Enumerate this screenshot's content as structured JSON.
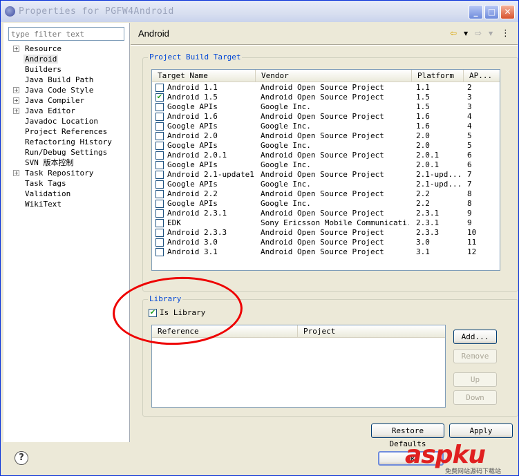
{
  "window": {
    "title": "Properties for PGFW4Android",
    "controls": [
      "minimize-icon",
      "maximize-icon",
      "close-icon"
    ]
  },
  "sidebar": {
    "filter_placeholder": "type filter text",
    "items": [
      {
        "label": "Resource",
        "expandable": true
      },
      {
        "label": "Android",
        "expandable": false,
        "selected": true
      },
      {
        "label": "Builders",
        "expandable": false
      },
      {
        "label": "Java Build Path",
        "expandable": false
      },
      {
        "label": "Java Code Style",
        "expandable": true
      },
      {
        "label": "Java Compiler",
        "expandable": true
      },
      {
        "label": "Java Editor",
        "expandable": true
      },
      {
        "label": "Javadoc Location",
        "expandable": false
      },
      {
        "label": "Project References",
        "expandable": false
      },
      {
        "label": "Refactoring History",
        "expandable": false
      },
      {
        "label": "Run/Debug Settings",
        "expandable": false
      },
      {
        "label": "SVN 版本控制",
        "expandable": false
      },
      {
        "label": "Task Repository",
        "expandable": true
      },
      {
        "label": "Task Tags",
        "expandable": false
      },
      {
        "label": "Validation",
        "expandable": false
      },
      {
        "label": "WikiText",
        "expandable": false
      }
    ]
  },
  "main": {
    "title": "Android",
    "nav": {
      "back_icon": "back-arrow-icon",
      "forward_icon": "forward-arrow-icon"
    },
    "build_target": {
      "label": "Project Build Target",
      "columns": [
        "Target Name",
        "Vendor",
        "Platform",
        "AP..."
      ],
      "rows": [
        {
          "checked": false,
          "name": "Android 1.1",
          "vendor": "Android Open Source Project",
          "platform": "1.1",
          "api": "2"
        },
        {
          "checked": true,
          "name": "Android 1.5",
          "vendor": "Android Open Source Project",
          "platform": "1.5",
          "api": "3"
        },
        {
          "checked": false,
          "name": "Google APIs",
          "vendor": "Google Inc.",
          "platform": "1.5",
          "api": "3"
        },
        {
          "checked": false,
          "name": "Android 1.6",
          "vendor": "Android Open Source Project",
          "platform": "1.6",
          "api": "4"
        },
        {
          "checked": false,
          "name": "Google APIs",
          "vendor": "Google Inc.",
          "platform": "1.6",
          "api": "4"
        },
        {
          "checked": false,
          "name": "Android 2.0",
          "vendor": "Android Open Source Project",
          "platform": "2.0",
          "api": "5"
        },
        {
          "checked": false,
          "name": "Google APIs",
          "vendor": "Google Inc.",
          "platform": "2.0",
          "api": "5"
        },
        {
          "checked": false,
          "name": "Android 2.0.1",
          "vendor": "Android Open Source Project",
          "platform": "2.0.1",
          "api": "6"
        },
        {
          "checked": false,
          "name": "Google APIs",
          "vendor": "Google Inc.",
          "platform": "2.0.1",
          "api": "6"
        },
        {
          "checked": false,
          "name": "Android 2.1-update1",
          "vendor": "Android Open Source Project",
          "platform": "2.1-upd...",
          "api": "7"
        },
        {
          "checked": false,
          "name": "Google APIs",
          "vendor": "Google Inc.",
          "platform": "2.1-upd...",
          "api": "7"
        },
        {
          "checked": false,
          "name": "Android 2.2",
          "vendor": "Android Open Source Project",
          "platform": "2.2",
          "api": "8"
        },
        {
          "checked": false,
          "name": "Google APIs",
          "vendor": "Google Inc.",
          "platform": "2.2",
          "api": "8"
        },
        {
          "checked": false,
          "name": "Android 2.3.1",
          "vendor": "Android Open Source Project",
          "platform": "2.3.1",
          "api": "9"
        },
        {
          "checked": false,
          "name": "EDK",
          "vendor": "Sony Ericsson Mobile Communicati...",
          "platform": "2.3.1",
          "api": "9"
        },
        {
          "checked": false,
          "name": "Android 2.3.3",
          "vendor": "Android Open Source Project",
          "platform": "2.3.3",
          "api": "10"
        },
        {
          "checked": false,
          "name": "Android 3.0",
          "vendor": "Android Open Source Project",
          "platform": "3.0",
          "api": "11"
        },
        {
          "checked": false,
          "name": "Android 3.1",
          "vendor": "Android Open Source Project",
          "platform": "3.1",
          "api": "12"
        }
      ]
    },
    "library": {
      "label": "Library",
      "is_library_label": "Is Library",
      "is_library_checked": true,
      "columns": [
        "Reference",
        "Project"
      ],
      "buttons": {
        "add": "Add...",
        "remove": "Remove",
        "up": "Up",
        "down": "Down"
      }
    },
    "restore_defaults": "Restore Defaults",
    "apply": "Apply"
  },
  "footer": {
    "help_icon": "help-icon",
    "ok_label": "OK"
  },
  "watermark": {
    "text": "aspku",
    "sub": "免费网站源码下载站"
  }
}
